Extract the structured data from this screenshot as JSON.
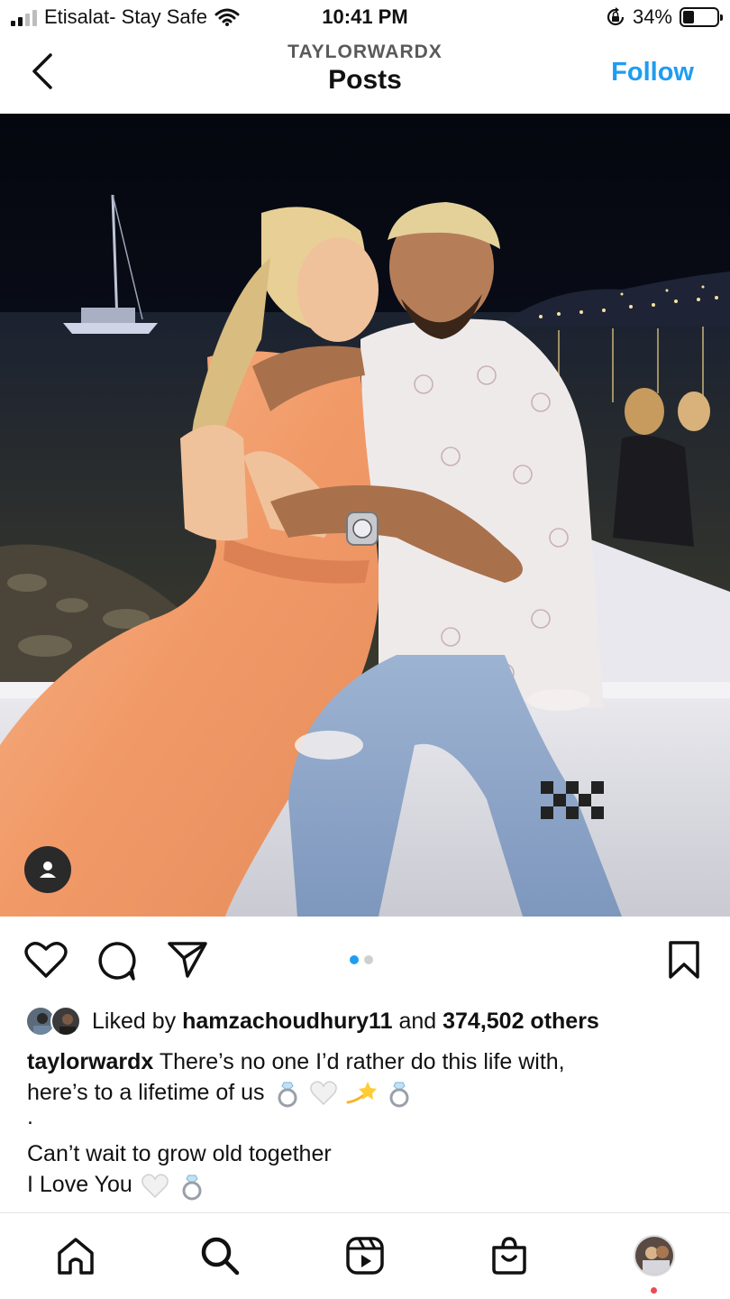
{
  "status_bar": {
    "carrier": "Etisalat- Stay Safe",
    "time": "10:41 PM",
    "battery_percent": "34%",
    "battery_level": 0.34,
    "icons": [
      "signal-icon",
      "wifi-icon",
      "orientation-lock-icon",
      "battery-icon"
    ]
  },
  "header": {
    "username": "TAYLORWARDX",
    "title": "Posts",
    "follow_label": "Follow",
    "back_icon": "chevron-left-icon"
  },
  "post": {
    "carousel_pages": 2,
    "carousel_current": 1,
    "liked_by_prefix": "Liked by",
    "liked_by_user": "hamzachoudhury11",
    "liked_by_and": "and",
    "liked_by_count": "374,502 others",
    "caption_user": "taylorwardx",
    "caption_line1": "There’s no one I’d rather do this life with,",
    "caption_line2": "here’s to a lifetime of us",
    "caption_line3": ".",
    "caption_line4": "Can’t wait to grow old together",
    "caption_line5": "I Love You",
    "caption_emojis_1": [
      "ring-emoji",
      "white-heart-emoji",
      "dizzy-emoji",
      "ring-emoji"
    ],
    "caption_emojis_2": [
      "white-heart-emoji",
      "ring-emoji"
    ]
  },
  "actions": [
    "heart-icon",
    "comment-icon",
    "share-icon",
    "bookmark-icon"
  ],
  "tabbar": [
    "home-icon",
    "search-icon",
    "reels-icon",
    "shop-icon",
    "profile-avatar"
  ],
  "colors": {
    "accent": "#1e9df1",
    "notification": "#ed4956",
    "dress": "#f3a274",
    "night_sky": "#0a0d18"
  }
}
